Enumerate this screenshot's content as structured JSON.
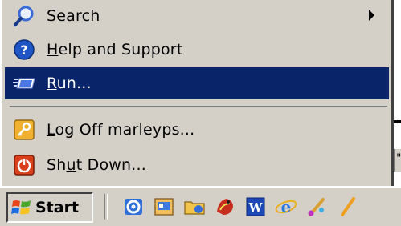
{
  "menu": {
    "items": [
      {
        "name": "search",
        "label": "Search",
        "accent": "#3b6bd6",
        "has_submenu": true,
        "icon": "search-icon"
      },
      {
        "name": "help",
        "label": "Help and Support",
        "accent": "#1f54c4",
        "has_submenu": false,
        "icon": "help-icon"
      },
      {
        "name": "run",
        "label": "Run...",
        "accent": "#0a246a",
        "has_submenu": false,
        "icon": "run-icon",
        "highlighted": true
      },
      {
        "name": "logoff",
        "label": "Log Off marleyps...",
        "accent": "#e8a020",
        "has_submenu": false,
        "icon": "key-icon"
      },
      {
        "name": "shutdown",
        "label": "Shut Down...",
        "accent": "#d8401c",
        "has_submenu": false,
        "icon": "power-icon"
      }
    ]
  },
  "taskbar": {
    "start_label": "Start",
    "quick_launch": [
      "outlook-icon",
      "desktop-icon",
      "folder-icon",
      "game-icon",
      "word-icon",
      "ie-icon",
      "paint-icon"
    ]
  },
  "colors": {
    "menu_bg": "#d4d0c8",
    "highlight_bg": "#0a246a",
    "highlight_text": "#ffffff"
  },
  "right_edge_text": "\""
}
